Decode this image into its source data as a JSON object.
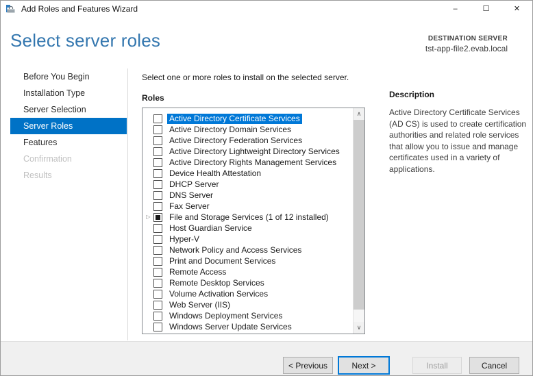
{
  "window": {
    "title": "Add Roles and Features Wizard",
    "controls": {
      "minimize": "–",
      "maximize": "☐",
      "close": "✕"
    }
  },
  "header": {
    "title": "Select server roles",
    "destination_label": "DESTINATION SERVER",
    "destination_server": "tst-app-file2.evab.local"
  },
  "sidebar": {
    "items": [
      {
        "label": "Before You Begin",
        "state": "normal"
      },
      {
        "label": "Installation Type",
        "state": "normal"
      },
      {
        "label": "Server Selection",
        "state": "normal"
      },
      {
        "label": "Server Roles",
        "state": "selected"
      },
      {
        "label": "Features",
        "state": "normal"
      },
      {
        "label": "Confirmation",
        "state": "disabled"
      },
      {
        "label": "Results",
        "state": "disabled"
      }
    ]
  },
  "main": {
    "instruction": "Select one or more roles to install on the selected server.",
    "list_label": "Roles",
    "roles": [
      {
        "label": "Active Directory Certificate Services",
        "checked": false,
        "selected": true,
        "expandable": false
      },
      {
        "label": "Active Directory Domain Services",
        "checked": false,
        "selected": false,
        "expandable": false
      },
      {
        "label": "Active Directory Federation Services",
        "checked": false,
        "selected": false,
        "expandable": false
      },
      {
        "label": "Active Directory Lightweight Directory Services",
        "checked": false,
        "selected": false,
        "expandable": false
      },
      {
        "label": "Active Directory Rights Management Services",
        "checked": false,
        "selected": false,
        "expandable": false
      },
      {
        "label": "Device Health Attestation",
        "checked": false,
        "selected": false,
        "expandable": false
      },
      {
        "label": "DHCP Server",
        "checked": false,
        "selected": false,
        "expandable": false
      },
      {
        "label": "DNS Server",
        "checked": false,
        "selected": false,
        "expandable": false
      },
      {
        "label": "Fax Server",
        "checked": false,
        "selected": false,
        "expandable": false
      },
      {
        "label": "File and Storage Services (1 of 12 installed)",
        "checked": "indeterminate",
        "selected": false,
        "expandable": true
      },
      {
        "label": "Host Guardian Service",
        "checked": false,
        "selected": false,
        "expandable": false
      },
      {
        "label": "Hyper-V",
        "checked": false,
        "selected": false,
        "expandable": false
      },
      {
        "label": "Network Policy and Access Services",
        "checked": false,
        "selected": false,
        "expandable": false
      },
      {
        "label": "Print and Document Services",
        "checked": false,
        "selected": false,
        "expandable": false
      },
      {
        "label": "Remote Access",
        "checked": false,
        "selected": false,
        "expandable": false
      },
      {
        "label": "Remote Desktop Services",
        "checked": false,
        "selected": false,
        "expandable": false
      },
      {
        "label": "Volume Activation Services",
        "checked": false,
        "selected": false,
        "expandable": false
      },
      {
        "label": "Web Server (IIS)",
        "checked": false,
        "selected": false,
        "expandable": false
      },
      {
        "label": "Windows Deployment Services",
        "checked": false,
        "selected": false,
        "expandable": false
      },
      {
        "label": "Windows Server Update Services",
        "checked": false,
        "selected": false,
        "expandable": false
      }
    ]
  },
  "description": {
    "title": "Description",
    "text": "Active Directory Certificate Services (AD CS) is used to create certification authorities and related role services that allow you to issue and manage certificates used in a variety of applications."
  },
  "footer": {
    "buttons": [
      {
        "label": "< Previous",
        "state": "normal"
      },
      {
        "label": "Next >",
        "state": "default"
      },
      {
        "label": "Install",
        "state": "disabled"
      },
      {
        "label": "Cancel",
        "state": "normal"
      }
    ]
  },
  "icons": {
    "expander": "▷",
    "scroll_up": "∧",
    "scroll_down": "∨"
  },
  "colors": {
    "accent": "#0072c6",
    "selection": "#0078d7",
    "heading": "#3477af"
  }
}
